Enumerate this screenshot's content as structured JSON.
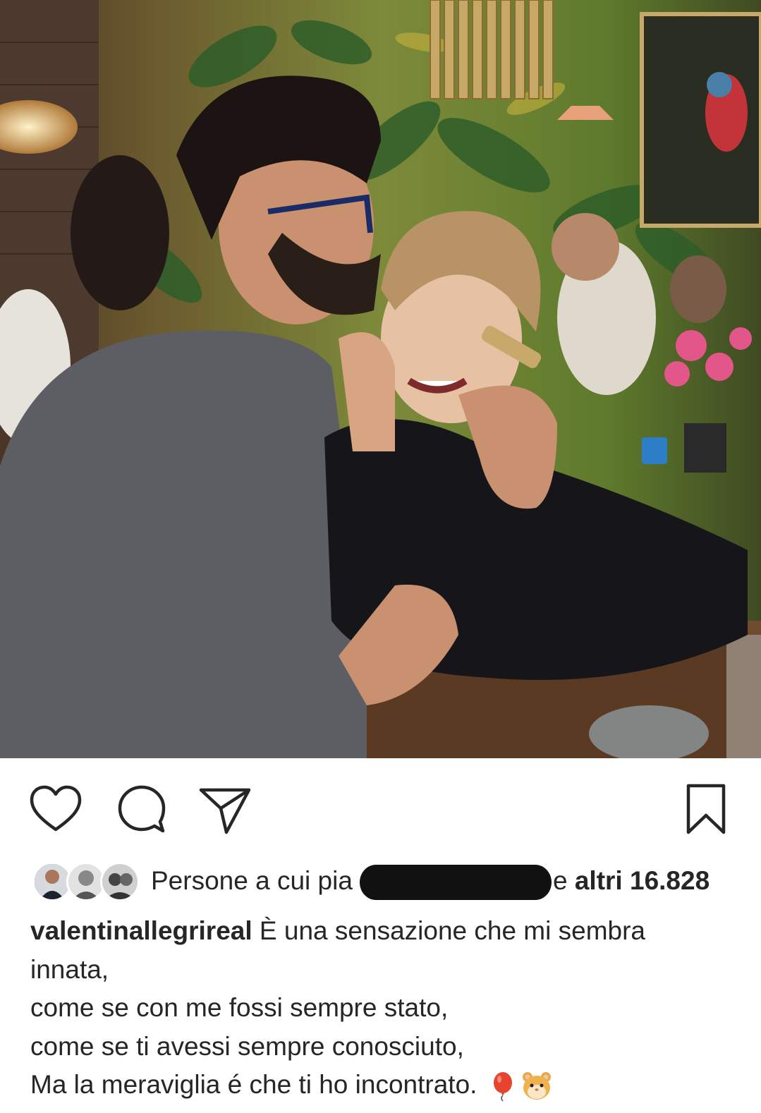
{
  "post": {
    "photo_icon": "photo-couple-restaurant",
    "actions": {
      "like_icon": "heart-icon",
      "comment_icon": "comment-bubble-icon",
      "share_icon": "paper-plane-icon",
      "save_icon": "bookmark-icon"
    },
    "likes": {
      "prefix": "Persone a cui pia",
      "suffix": "e ",
      "count_label": "altri 16.828"
    },
    "caption": {
      "username": "valentinallegrireal",
      "first_line": " È una sensazione che mi sembra",
      "lines": [
        "innata,",
        "come se con me fossi sempre stato,",
        "come se ti avessi sempre conosciuto,",
        "Ma la meraviglia é che ti ho incontrato."
      ],
      "emojis": [
        "balloon-emoji",
        "hamster-face-emoji"
      ]
    }
  },
  "colors": {
    "text": "#262626",
    "background": "#ffffff",
    "icon_stroke": "#262626"
  }
}
